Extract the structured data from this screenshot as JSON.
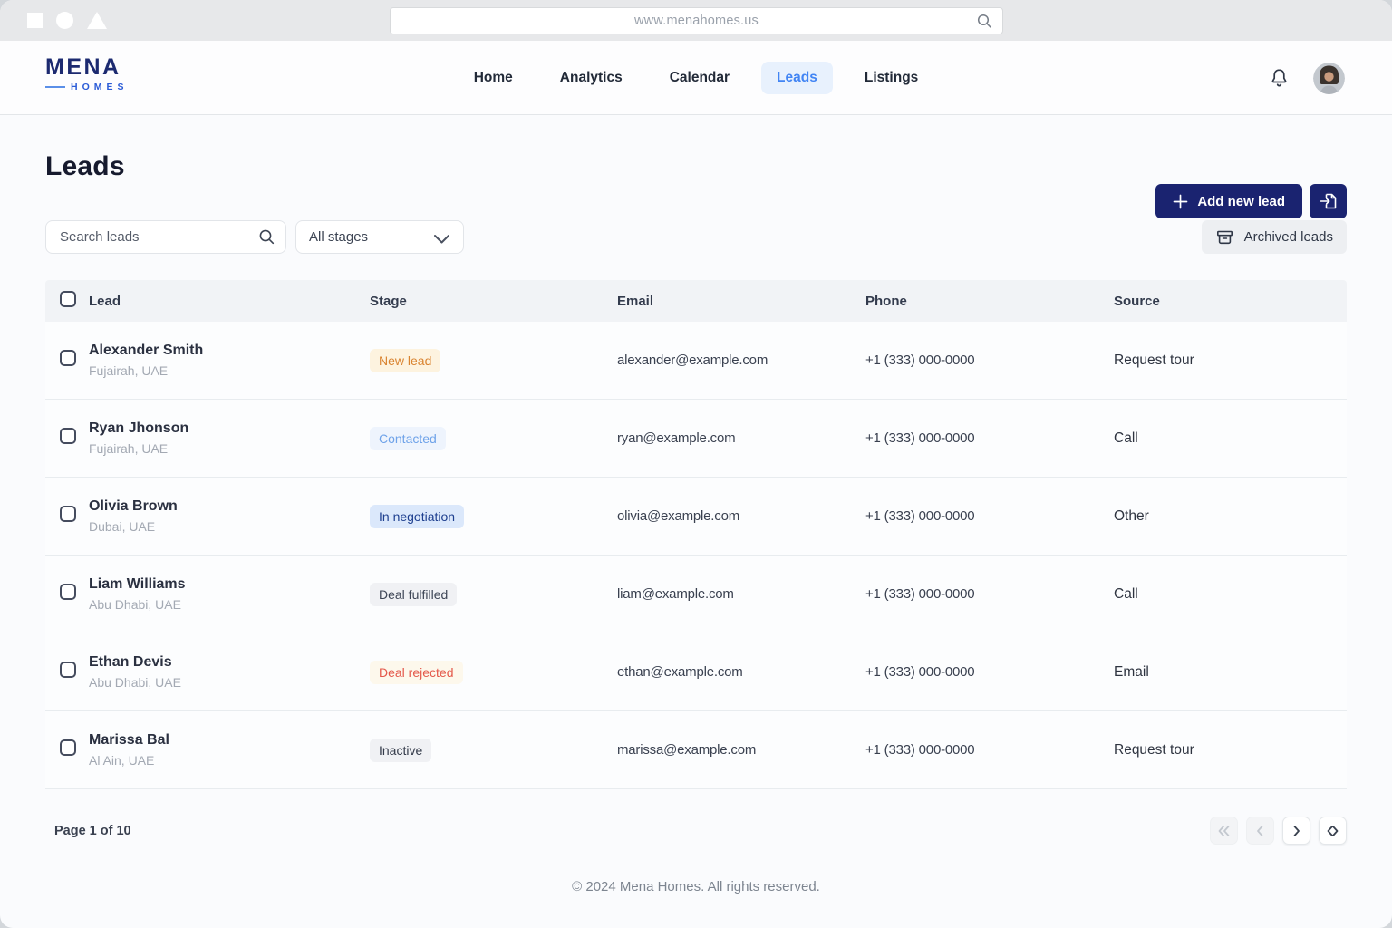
{
  "browser": {
    "url": "www.menahomes.us"
  },
  "brand": {
    "name": "MENA",
    "sub": "HOMES"
  },
  "nav": {
    "items": [
      {
        "label": "Home",
        "active": false
      },
      {
        "label": "Analytics",
        "active": false
      },
      {
        "label": "Calendar",
        "active": false
      },
      {
        "label": "Leads",
        "active": true
      },
      {
        "label": "Listings",
        "active": false
      }
    ]
  },
  "page": {
    "title": "Leads",
    "add_button_label": "Add new lead",
    "archived_button_label": "Archived leads",
    "search_placeholder": "Search leads",
    "stage_filter_value": "All stages"
  },
  "colors": {
    "primary_navy": "#1a2370",
    "accent_blue": "#4285f4",
    "active_nav_bg": "#e8f1fd"
  },
  "stage_styles": {
    "new_lead": {
      "fg": "#d9832f",
      "bg": "#fdf3df"
    },
    "contacted": {
      "fg": "#6fa3e9",
      "bg": "#eef4fd"
    },
    "in_negotiation": {
      "fg": "#1e3f8f",
      "bg": "#dbe8fb"
    },
    "deal_fulfilled": {
      "fg": "#3e4656",
      "bg": "#f0f1f4"
    },
    "deal_rejected": {
      "fg": "#e4584a",
      "bg": "#fdf8ec"
    },
    "inactive": {
      "fg": "#333a49",
      "bg": "#f0f1f4"
    }
  },
  "table": {
    "columns": [
      "Lead",
      "Stage",
      "Email",
      "Phone",
      "Source"
    ],
    "rows": [
      {
        "name": "Alexander Smith",
        "location": "Fujairah, UAE",
        "stage": "New lead",
        "stage_key": "new_lead",
        "email": "alexander@example.com",
        "phone": "+1 (333) 000-0000",
        "source": "Request tour"
      },
      {
        "name": "Ryan Jhonson",
        "location": "Fujairah, UAE",
        "stage": "Contacted",
        "stage_key": "contacted",
        "email": "ryan@example.com",
        "phone": "+1 (333) 000-0000",
        "source": "Call"
      },
      {
        "name": "Olivia Brown",
        "location": "Dubai, UAE",
        "stage": "In negotiation",
        "stage_key": "in_negotiation",
        "email": "olivia@example.com",
        "phone": "+1 (333) 000-0000",
        "source": "Other"
      },
      {
        "name": "Liam Williams",
        "location": "Abu Dhabi, UAE",
        "stage": "Deal fulfilled",
        "stage_key": "deal_fulfilled",
        "email": "liam@example.com",
        "phone": "+1 (333) 000-0000",
        "source": "Call"
      },
      {
        "name": "Ethan Devis",
        "location": "Abu Dhabi, UAE",
        "stage": "Deal rejected",
        "stage_key": "deal_rejected",
        "email": "ethan@example.com",
        "phone": "+1 (333) 000-0000",
        "source": "Email"
      },
      {
        "name": "Marissa Bal",
        "location": "Al Ain, UAE",
        "stage": "Inactive",
        "stage_key": "inactive",
        "email": "marissa@example.com",
        "phone": "+1 (333) 000-0000",
        "source": "Request tour"
      }
    ]
  },
  "pagination": {
    "label": "Page 1 of 10"
  },
  "footer": {
    "copyright": "© 2024 Mena Homes. All rights reserved."
  }
}
